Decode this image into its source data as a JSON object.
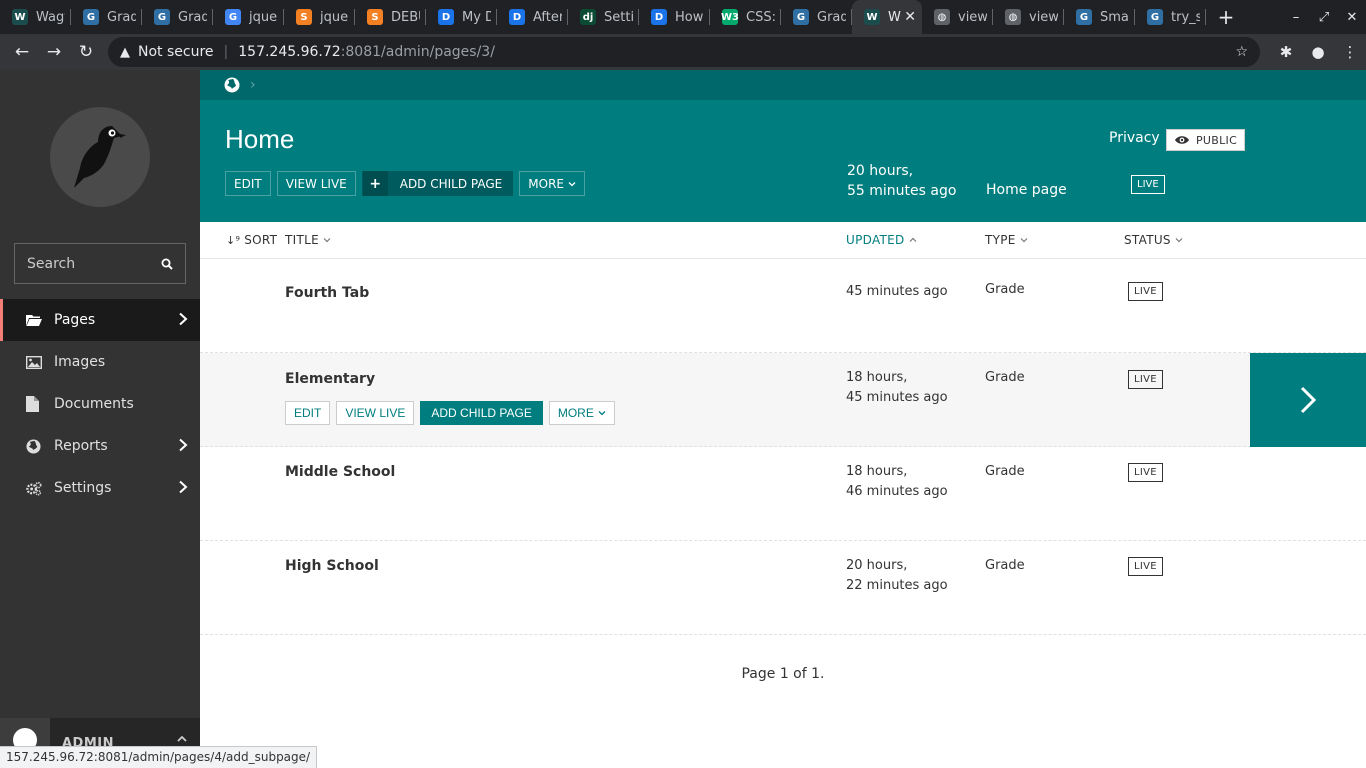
{
  "browser": {
    "tabs": [
      {
        "label": "Wagt",
        "favicon": "W",
        "color": "#1b4d4f"
      },
      {
        "label": "Grad",
        "favicon": "G",
        "color": "#2f6fa3"
      },
      {
        "label": "Grad",
        "favicon": "G",
        "color": "#2f6fa3"
      },
      {
        "label": "jquer",
        "favicon": "G",
        "color": "#4285f4"
      },
      {
        "label": "jquer",
        "favicon": "S",
        "color": "#f48024"
      },
      {
        "label": "DEBU",
        "favicon": "S",
        "color": "#f48024"
      },
      {
        "label": "My Dj",
        "favicon": "D",
        "color": "#1a73e8"
      },
      {
        "label": "After",
        "favicon": "D",
        "color": "#1a73e8"
      },
      {
        "label": "Settir",
        "favicon": "dj",
        "color": "#0c4b33"
      },
      {
        "label": "How",
        "favicon": "D",
        "color": "#1a73e8"
      },
      {
        "label": "CSS: c",
        "favicon": "W3",
        "color": "#04aa6d"
      },
      {
        "label": "Grad",
        "favicon": "G",
        "color": "#2f6fa3"
      },
      {
        "label": "W",
        "favicon": "W",
        "color": "#1b4d4f",
        "active": true
      },
      {
        "label": "view-",
        "favicon": "◍",
        "color": "#5f6368"
      },
      {
        "label": "view-",
        "favicon": "◍",
        "color": "#5f6368"
      },
      {
        "label": "Smar",
        "favicon": "G",
        "color": "#2f6fa3"
      },
      {
        "label": "try_s",
        "favicon": "G",
        "color": "#2f6fa3"
      }
    ],
    "security_label": "Not secure",
    "url_host": "157.245.96.72",
    "url_path": ":8081/admin/pages/3/",
    "status_url": "157.245.96.72:8081/admin/pages/4/add_subpage/"
  },
  "sidebar": {
    "search_placeholder": "Search",
    "items": [
      {
        "label": "Pages",
        "icon": "folder-open-icon",
        "has_children": true,
        "active": true
      },
      {
        "label": "Images",
        "icon": "image-icon",
        "has_children": false
      },
      {
        "label": "Documents",
        "icon": "document-icon",
        "has_children": false
      },
      {
        "label": "Reports",
        "icon": "globe-icon",
        "has_children": true
      },
      {
        "label": "Settings",
        "icon": "cogs-icon",
        "has_children": true
      }
    ],
    "account_name": "ADMIN"
  },
  "header": {
    "title": "Home",
    "buttons": {
      "edit": "EDIT",
      "view_live": "VIEW LIVE",
      "add_child": "ADD CHILD PAGE",
      "more": "MORE"
    },
    "updated_line1": "20 hours,",
    "updated_line2": "55 minutes ago",
    "type": "Home page",
    "status": "LIVE",
    "privacy_label": "Privacy",
    "privacy_value": "PUBLIC"
  },
  "table": {
    "columns": {
      "sort": "SORT",
      "title": "TITLE",
      "updated": "UPDATED",
      "type": "TYPE",
      "status": "STATUS"
    },
    "rows": [
      {
        "title": "Fourth Tab",
        "updated1": "45 minutes ago",
        "updated2": "",
        "type": "Grade",
        "status": "LIVE"
      },
      {
        "title": "Elementary",
        "updated1": "18 hours,",
        "updated2": "45 minutes ago",
        "type": "Grade",
        "status": "LIVE"
      },
      {
        "title": "Middle School",
        "updated1": "18 hours,",
        "updated2": "46 minutes ago",
        "type": "Grade",
        "status": "LIVE"
      },
      {
        "title": "High School",
        "updated1": "20 hours,",
        "updated2": "22 minutes ago",
        "type": "Grade",
        "status": "LIVE"
      }
    ],
    "row_buttons": {
      "edit": "EDIT",
      "view_live": "VIEW LIVE",
      "add_child": "ADD CHILD PAGE",
      "more": "MORE"
    }
  },
  "pagination": "Page 1 of 1."
}
